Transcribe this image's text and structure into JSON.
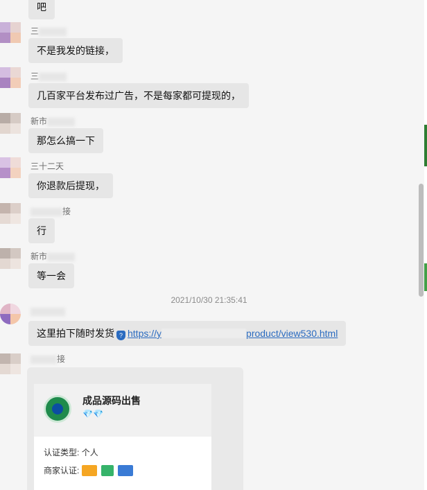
{
  "messages": [
    {
      "text": "吧"
    },
    {
      "name": "三",
      "text": "不是我发的链接，"
    },
    {
      "name": "三",
      "text": "几百家平台发布过广告，不是每家都可提现的，"
    },
    {
      "name": "新市",
      "text": "那怎么搞一下"
    },
    {
      "name": "三十二天",
      "text": "你退款后提现，"
    },
    {
      "name": "接",
      "text": "行"
    },
    {
      "name": "新市",
      "text": "等一会"
    }
  ],
  "timestamp": "2021/10/30 21:35:41",
  "link_message": {
    "prefix": "这里拍下随时发货",
    "link_start": "https://y",
    "link_end": "product/view530.html"
  },
  "last_sender": "接",
  "card": {
    "title": "成品源码出售",
    "diamonds": "💎💎",
    "type_label": "认证类型:",
    "type_value": "个人",
    "merchant_label": "商家认证:"
  },
  "colors": {
    "accent": "#2a6bc0",
    "bubble": "#e6e6e6",
    "background": "#f5f5f5"
  }
}
